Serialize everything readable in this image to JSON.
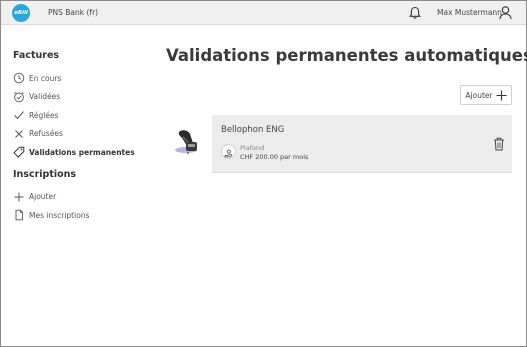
{
  "header": {
    "logo_text": "eBill",
    "bank_name": "PNS Bank (fr)",
    "user_name": "Max Mustermann",
    "brand_color": "#2aa7d8"
  },
  "sidebar": {
    "factures_heading": "Factures",
    "factures_items": [
      {
        "label": "En cours",
        "icon": "clock-icon"
      },
      {
        "label": "Validées",
        "icon": "clock-check-icon"
      },
      {
        "label": "Réglées",
        "icon": "check-icon"
      },
      {
        "label": "Refusées",
        "icon": "x-icon"
      },
      {
        "label": "Validations permanentes",
        "icon": "tag-icon",
        "active": true
      }
    ],
    "inscriptions_heading": "Inscriptions",
    "inscriptions_items": [
      {
        "label": "Ajouter",
        "icon": "plus-icon"
      },
      {
        "label": "Mes inscriptions",
        "icon": "document-icon"
      }
    ]
  },
  "main": {
    "title": "Validations permanentes automatiques",
    "add_button_label": "Ajouter",
    "card": {
      "title": "Bellophon ENG",
      "limit_label": "Plafond",
      "limit_value": "CHF 200.00 par mois"
    }
  }
}
